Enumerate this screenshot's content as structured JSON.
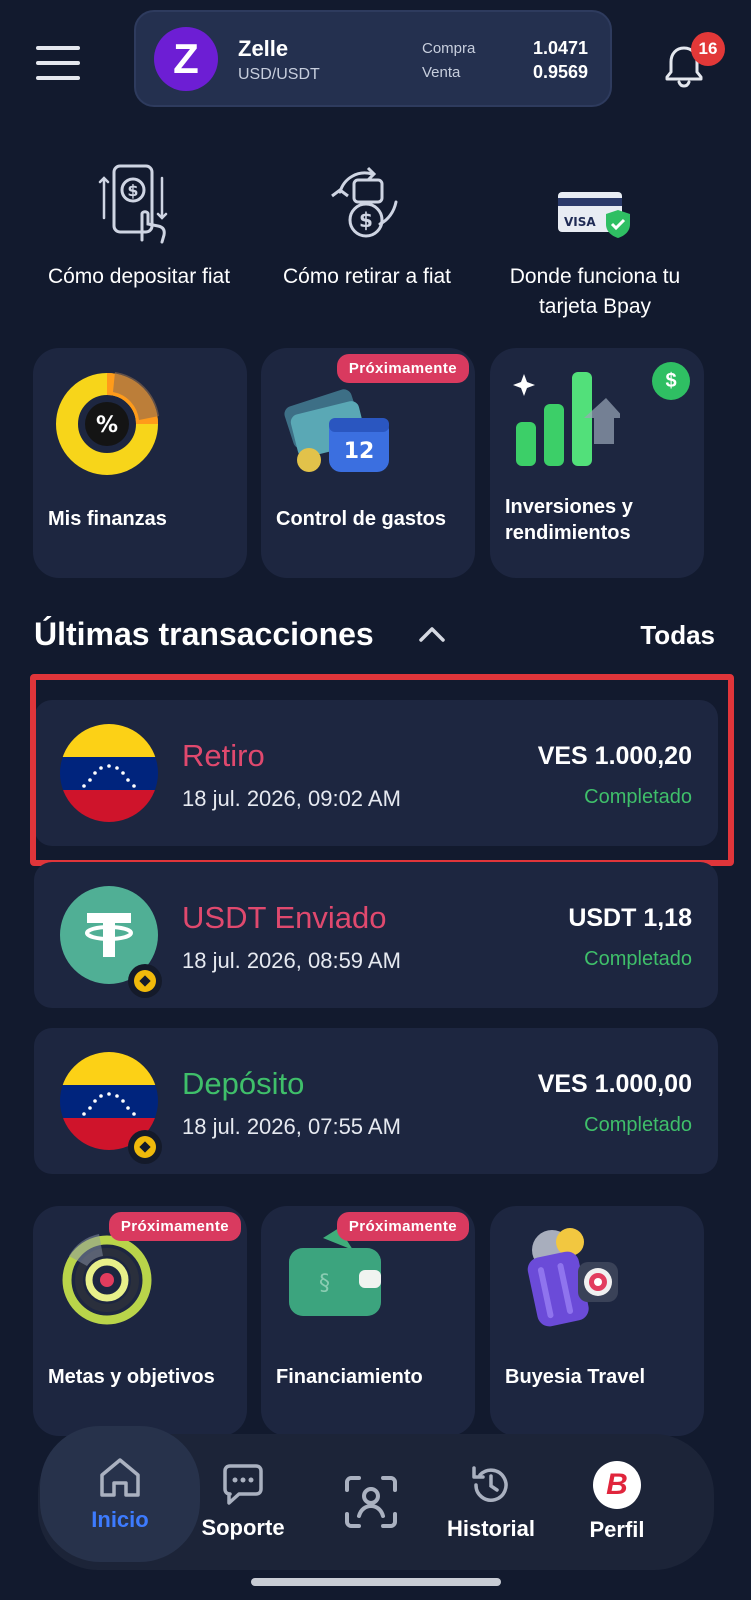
{
  "header": {
    "rate": {
      "name": "Zelle",
      "pair": "USD/USDT",
      "buy_label": "Compra",
      "buy_value": "1.0471",
      "sell_label": "Venta",
      "sell_value": "0.9569",
      "logo_letter": "Z"
    },
    "notifications_count": "16"
  },
  "guides": [
    {
      "label": "Cómo depositar fiat",
      "icon": "phone-dollar-icon"
    },
    {
      "label": "Cómo retirar a fiat",
      "icon": "cash-exchange-icon"
    },
    {
      "label": "Donde funciona tu tarjeta Bpay",
      "icon": "visa-card-icon",
      "card_text": "VISA"
    }
  ],
  "features_top": [
    {
      "label": "Mis finanzas",
      "icon": "donut-chart-icon"
    },
    {
      "label": "Control de gastos",
      "badge": "Próximamente",
      "icon": "calendar-cards-icon",
      "calendar_day": "12"
    },
    {
      "label": "Inversiones y rendimientos",
      "icon": "growth-bars-icon",
      "coin_symbol": "$"
    }
  ],
  "transactions_section": {
    "title": "Últimas transacciones",
    "all_label": "Todas"
  },
  "transactions": [
    {
      "title": "Retiro",
      "date": "18 jul. 2026, 09:02 AM",
      "amount": "VES 1.000,20",
      "status": "Completado",
      "title_color": "#e0496e",
      "avatar": "venezuela-flag"
    },
    {
      "title": "USDT Enviado",
      "date": "18 jul. 2026, 08:59 AM",
      "amount": "USDT 1,18",
      "status": "Completado",
      "title_color": "#e0496e",
      "avatar": "tether-logo"
    },
    {
      "title": "Depósito",
      "date": "18 jul. 2026, 07:55 AM",
      "amount": "VES 1.000,00",
      "status": "Completado",
      "title_color": "#3fbf6a",
      "avatar": "venezuela-flag"
    }
  ],
  "features_bottom": [
    {
      "label": "Metas y objetivos",
      "badge": "Próximamente",
      "icon": "target-icon"
    },
    {
      "label": "Financiamiento",
      "badge": "Próximamente",
      "icon": "wallet-icon"
    },
    {
      "label": "Buyesia Travel",
      "icon": "suitcase-icon"
    }
  ],
  "nav": [
    {
      "label": "Inicio",
      "icon": "home-icon",
      "active": true
    },
    {
      "label": "Soporte",
      "icon": "chat-icon"
    },
    {
      "label": "",
      "icon": "scan-icon"
    },
    {
      "label": "Historial",
      "icon": "history-icon"
    },
    {
      "label": "Perfil",
      "icon": "profile-logo-icon",
      "logo_letter": "B"
    }
  ]
}
